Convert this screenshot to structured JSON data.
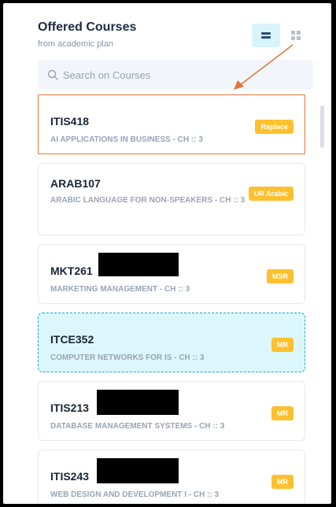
{
  "header": {
    "title": "Offered Courses",
    "subtitle": "from academic plan"
  },
  "search": {
    "placeholder": "Search on Courses",
    "icon": "search-icon"
  },
  "view_toggle": {
    "active": "list",
    "icons": [
      "list-view-icon",
      "grid-view-icon"
    ]
  },
  "colors": {
    "badge": "#fdc02f",
    "selected_border": "#e2763a",
    "highlight_bg": "#dcf7fb",
    "arrow": "#e2763a"
  },
  "courses": [
    {
      "code": "ITIS418",
      "name": "AI APPLICATIONS IN BUSINESS - CH :: 3",
      "badge": "Replace"
    },
    {
      "code": "ARAB107",
      "name": "ARABIC LANGUAGE FOR NON-SPEAKERS - CH :: 3",
      "badge": "UR Arabic"
    },
    {
      "code": "MKT261",
      "name": "MARKETING MANAGEMENT - CH :: 3",
      "badge": "MSR"
    },
    {
      "code": "ITCE352",
      "name": "COMPUTER NETWORKS FOR IS - CH :: 3",
      "badge": "MR"
    },
    {
      "code": "ITIS213",
      "name": "DATABASE MANAGEMENT SYSTEMS - CH :: 3",
      "badge": "MR"
    },
    {
      "code": "ITIS243",
      "name": "WEB DESIGN AND DEVELOPMENT I - CH :: 3",
      "badge": "MR"
    }
  ]
}
